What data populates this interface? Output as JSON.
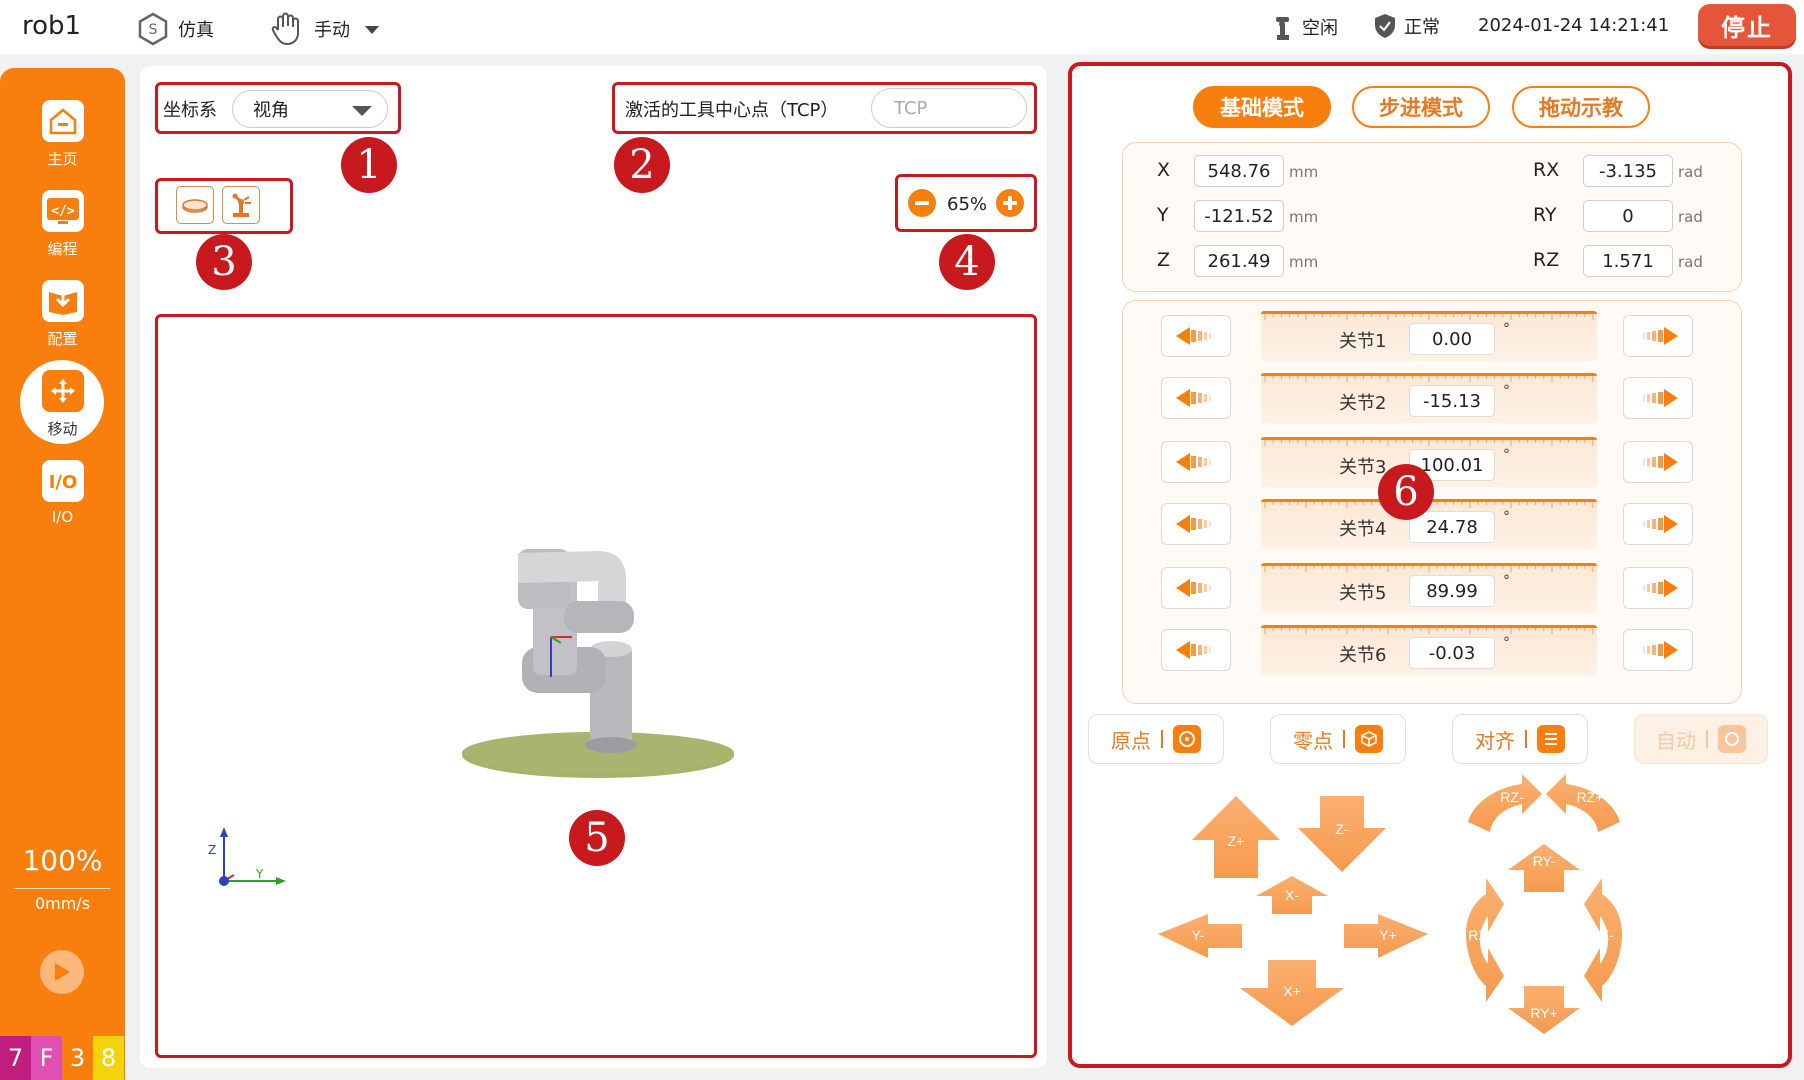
{
  "topbar": {
    "app_title": "rob1",
    "sim_label": "仿真",
    "mode_label": "手动",
    "status_label": "空闲",
    "health_label": "正常",
    "datetime": "2024-01-24 14:21:41",
    "stop_label": "停止"
  },
  "sidebar": {
    "items": [
      {
        "label": "主页"
      },
      {
        "label": "编程"
      },
      {
        "label": "配置"
      },
      {
        "label": "移动"
      },
      {
        "label": "I/O"
      }
    ],
    "speed_percent": "100%",
    "speed_ms": "0mm/s",
    "hex_strip": [
      {
        "char": "7",
        "color": "#c01d7e"
      },
      {
        "char": "F",
        "color": "#e04fb3"
      },
      {
        "char": "3",
        "color": "#f87e0d"
      },
      {
        "char": "8",
        "color": "#f4d30c"
      }
    ]
  },
  "middle": {
    "coord_label": "坐标系",
    "coord_value": "视角",
    "tcp_label": "激活的工具中心点（TCP）",
    "tcp_placeholder": "TCP",
    "zoom_value": "65%",
    "axis_z": "Z",
    "axis_y": "Y",
    "markers": [
      "1",
      "2",
      "3",
      "4",
      "5"
    ]
  },
  "right": {
    "marker": "6",
    "modes": [
      {
        "label": "基础模式",
        "active": true
      },
      {
        "label": "步进模式",
        "active": false
      },
      {
        "label": "拖动示教",
        "active": false
      }
    ],
    "cartesian": [
      {
        "axis": "X",
        "value": "548.76",
        "unit": "mm"
      },
      {
        "axis": "Y",
        "value": "-121.52",
        "unit": "mm"
      },
      {
        "axis": "Z",
        "value": "261.49",
        "unit": "mm"
      },
      {
        "axis": "RX",
        "value": "-3.135",
        "unit": "rad"
      },
      {
        "axis": "RY",
        "value": "0",
        "unit": "rad"
      },
      {
        "axis": "RZ",
        "value": "1.571",
        "unit": "rad"
      }
    ],
    "joints": [
      {
        "name": "关节1",
        "value": "0.00"
      },
      {
        "name": "关节2",
        "value": "-15.13"
      },
      {
        "name": "关节3",
        "value": "100.01"
      },
      {
        "name": "关节4",
        "value": "24.78"
      },
      {
        "name": "关节5",
        "value": "89.99"
      },
      {
        "name": "关节6",
        "value": "-0.03"
      }
    ],
    "degree_symbol": "°",
    "actions": [
      {
        "label": "原点",
        "disabled": false
      },
      {
        "label": "零点",
        "disabled": false
      },
      {
        "label": "对齐",
        "disabled": false
      },
      {
        "label": "自动",
        "disabled": true
      }
    ],
    "jog_linear": [
      "Z+",
      "Z-",
      "X-",
      "Y-",
      "Y+",
      "X+"
    ],
    "jog_rot": [
      "RZ-",
      "RZ+",
      "RY-",
      "RX+",
      "RX-",
      "RY+"
    ]
  },
  "colors": {
    "accent": "#f87e0d",
    "annotation_red": "#c8191e",
    "stop": "#e4553a",
    "floor_disc": "#a7b26c"
  }
}
